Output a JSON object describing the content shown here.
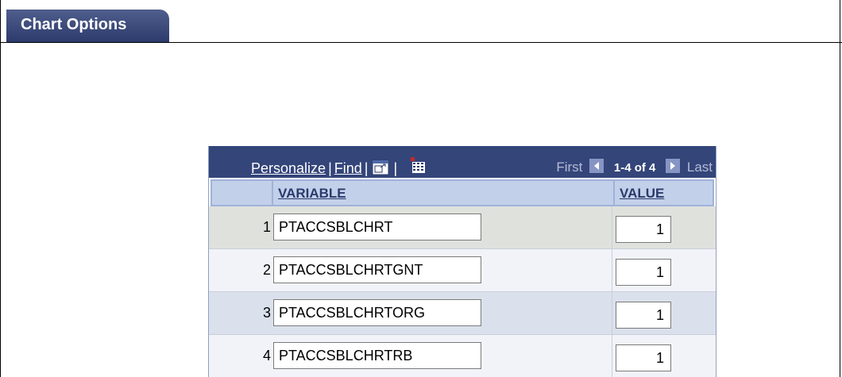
{
  "tabs": {
    "chart_options": "Chart Options"
  },
  "grid": {
    "nav": {
      "personalize": "Personalize",
      "find": "Find",
      "sep": "|",
      "first": "First",
      "range": "1-4 of 4",
      "last": "Last"
    },
    "columns": {
      "variable": "VARIABLE",
      "value": "VALUE"
    },
    "rows": [
      {
        "num": "1",
        "variable": "PTACCSBLCHRT",
        "value": "1"
      },
      {
        "num": "2",
        "variable": "PTACCSBLCHRTGNT",
        "value": "1"
      },
      {
        "num": "3",
        "variable": "PTACCSBLCHRTORG",
        "value": "1"
      },
      {
        "num": "4",
        "variable": "PTACCSBLCHRTRB",
        "value": "1"
      }
    ],
    "row_colors": [
      "#dfe1dd",
      "#f1f3f8",
      "#dbe1ec",
      "#f1f3f8"
    ],
    "icons": [
      "zoom-icon",
      "download-grid-icon",
      "first-arrow-icon",
      "next-arrow-icon"
    ]
  }
}
